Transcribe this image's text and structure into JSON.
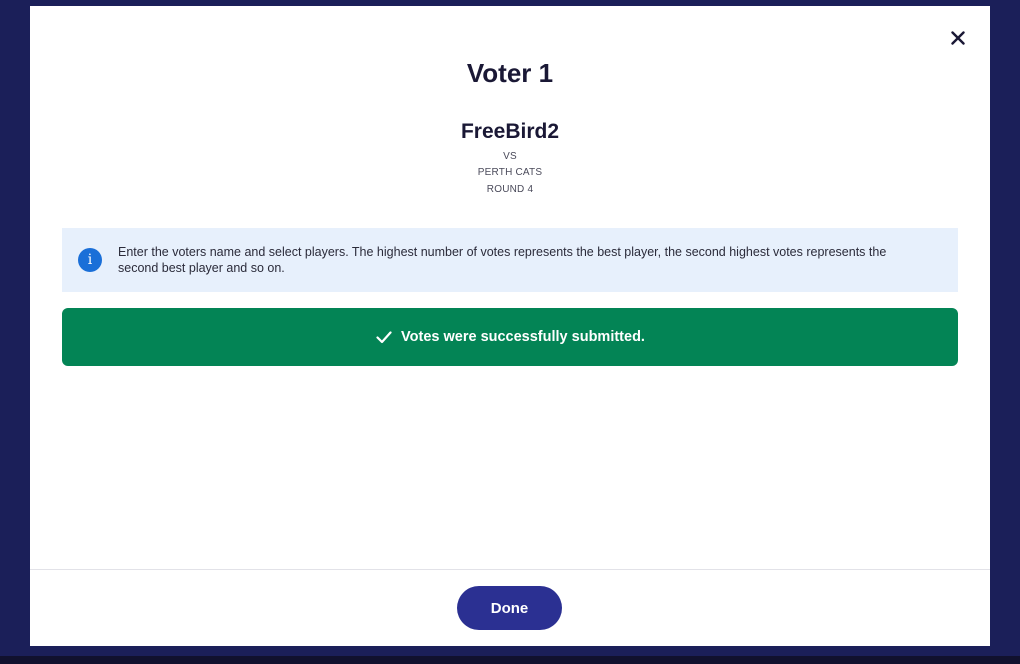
{
  "modal": {
    "title": "Voter 1",
    "team": "FreeBird2",
    "vs": "VS",
    "opponent": "PERTH CATS",
    "round": "ROUND 4",
    "info_icon_glyph": "i",
    "info_text": "Enter the voters name and select players. The highest number of votes represents the best player, the second highest votes represents the second best player and so on.",
    "success_message": "Votes were successfully submitted.",
    "done_label": "Done",
    "icons": {
      "close": "close-icon",
      "info": "info-icon",
      "check": "check-icon"
    }
  },
  "colors": {
    "backdrop": "#1b1f59",
    "success": "#038455",
    "info_bg": "#e7f0fc",
    "info_icon": "#1a6fd8",
    "primary_button": "#2b3092"
  }
}
